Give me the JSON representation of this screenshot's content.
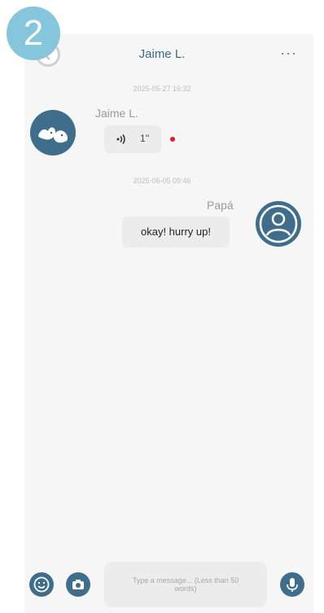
{
  "step_badge": "2",
  "header": {
    "title": "Jaime L.",
    "more": "···"
  },
  "messages": [
    {
      "timestamp": "2025-05-27 16:32",
      "sender": "Jaime L.",
      "type": "voice",
      "duration": "1''"
    },
    {
      "timestamp": "2025-06-05 09:46",
      "sender": "Papá",
      "type": "text",
      "text": "okay! hurry up!"
    }
  ],
  "composer": {
    "placeholder": "Type a message... (Less than 50 words)"
  },
  "colors": {
    "accent": "#3f6e8c",
    "bubble": "#ececec",
    "unread_dot": "#e11b27",
    "badge": "#86c6dd"
  },
  "icons": {
    "back": "back-icon",
    "more": "more-icon",
    "emoji": "emoji-icon",
    "camera": "camera-icon",
    "mic": "mic-icon",
    "speaker": "speaker-icon"
  }
}
